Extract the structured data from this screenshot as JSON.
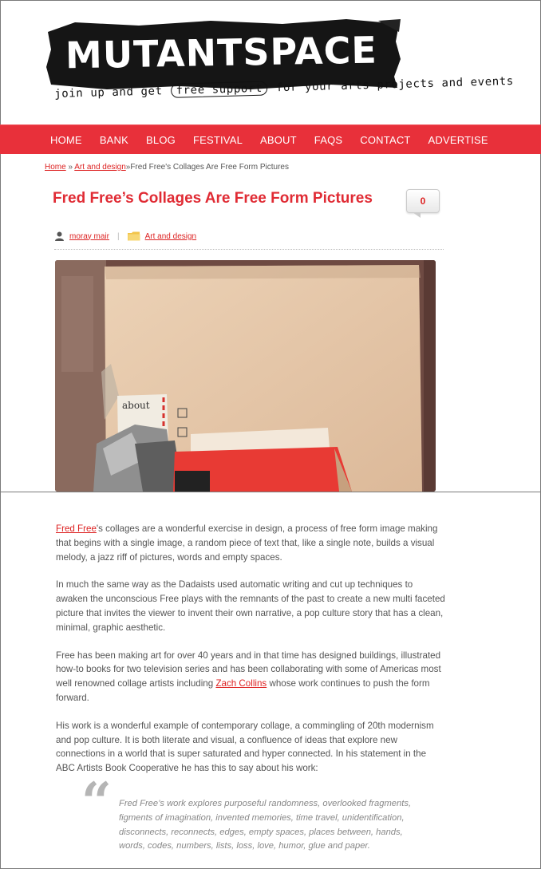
{
  "site": {
    "logo": "MUTANTSPACE",
    "tagline_before": "join up and get",
    "tagline_boxed": "free support",
    "tagline_after": "for your arts projects and events"
  },
  "nav": [
    "HOME",
    "BANK",
    "BLOG",
    "FESTIVAL",
    "ABOUT",
    "FAQS",
    "CONTACT",
    "ADVERTISE"
  ],
  "breadcrumb": {
    "home": "Home",
    "sep1": " » ",
    "category": "Art and design",
    "sep2": "»",
    "current": "Fred Free's Collages Are Free Form Pictures"
  },
  "post": {
    "title": "Fred Free’s Collages Are Free Form Pictures",
    "comment_count": "0",
    "author": "moray mair",
    "meta_sep": "|",
    "category": "Art and design",
    "image_text": "about"
  },
  "article": {
    "p1_link": "Fred Free",
    "p1_rest": "'s collages are a wonderful exercise in design, a process of free form image making that begins with a single image, a random piece of text that, like a single note, builds a visual melody, a jazz riff of pictures, words and empty spaces.",
    "p2": "In much the same way as the Dadaists used automatic writing and cut up techniques to awaken the unconscious Free plays with the remnants of the past to create a new multi faceted picture that invites the viewer to invent their own narrative, a pop culture story that has a clean, minimal, graphic aesthetic.",
    "p3_before": "Free has been making art for over 40 years and in that time has designed buildings, illustrated how-to books for two television series and has been collaborating with some of Americas most well renowned collage artists including ",
    "p3_link": "Zach Collins",
    "p3_after": " whose work continues to push the form forward.",
    "p4": "His work is a wonderful example of contemporary collage, a commingling of 20th modernism and pop culture. It is both literate and visual, a confluence of ideas that explore new connections in a world that is super saturated and hyper connected. In his statement in the ABC Artists Book Cooperative he has this to say about his work:",
    "quote_mark": "“",
    "quote": "Fred Free’s work explores purposeful randomness, overlooked fragments, figments of imagination, invented memories, time travel, unidentification, disconnects, reconnects, edges, empty spaces, places between, hands, words, codes, numbers, lists, loss, love, humor, glue and paper."
  },
  "colors": {
    "accent": "#e8303a",
    "link": "#dd2222"
  }
}
